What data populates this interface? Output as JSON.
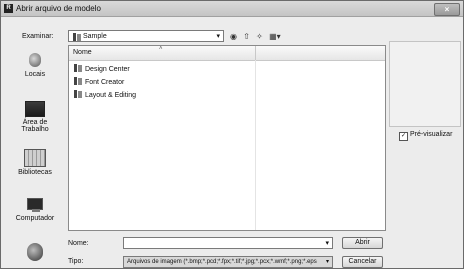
{
  "window": {
    "title": "Abrir arquivo de modelo",
    "app_icon_text": "R",
    "close_glyph": "×"
  },
  "lookin": {
    "label": "Examinar:",
    "value": "Sample",
    "arrow": "▾"
  },
  "toolbar": {
    "icons": [
      "back-icon",
      "up-folder-icon",
      "new-folder-icon",
      "views-menu-icon"
    ],
    "glyphs": [
      "◉",
      "⇧",
      "✧",
      "▦▾"
    ]
  },
  "places": [
    {
      "label": "Locais",
      "icon": "recent-places-icon"
    },
    {
      "label": "Área de Trabalho",
      "icon": "desktop-icon"
    },
    {
      "label": "Bibliotecas",
      "icon": "libraries-icon"
    },
    {
      "label": "Computador",
      "icon": "computer-icon"
    },
    {
      "label": "",
      "icon": "network-icon"
    }
  ],
  "filelist": {
    "column_name": "Nome",
    "sort_glyph": "˄",
    "items": [
      "Design Center",
      "Font Creator",
      "Layout & Editing"
    ]
  },
  "preview": {
    "checkbox_label": "Pré-visualizar",
    "checked": true,
    "check_glyph": "✓"
  },
  "filename": {
    "label": "Nome:",
    "value": "",
    "arrow": "▾"
  },
  "filetype": {
    "label": "Tipo:",
    "value": "Arquivos de imagem (*.bmp;*.pcd;*.fpx;*.tif;*.jpg;*.pcx;*.wmf;*.png;*.eps",
    "arrow": "▾"
  },
  "buttons": {
    "open": "Abrir",
    "cancel": "Cancelar"
  }
}
